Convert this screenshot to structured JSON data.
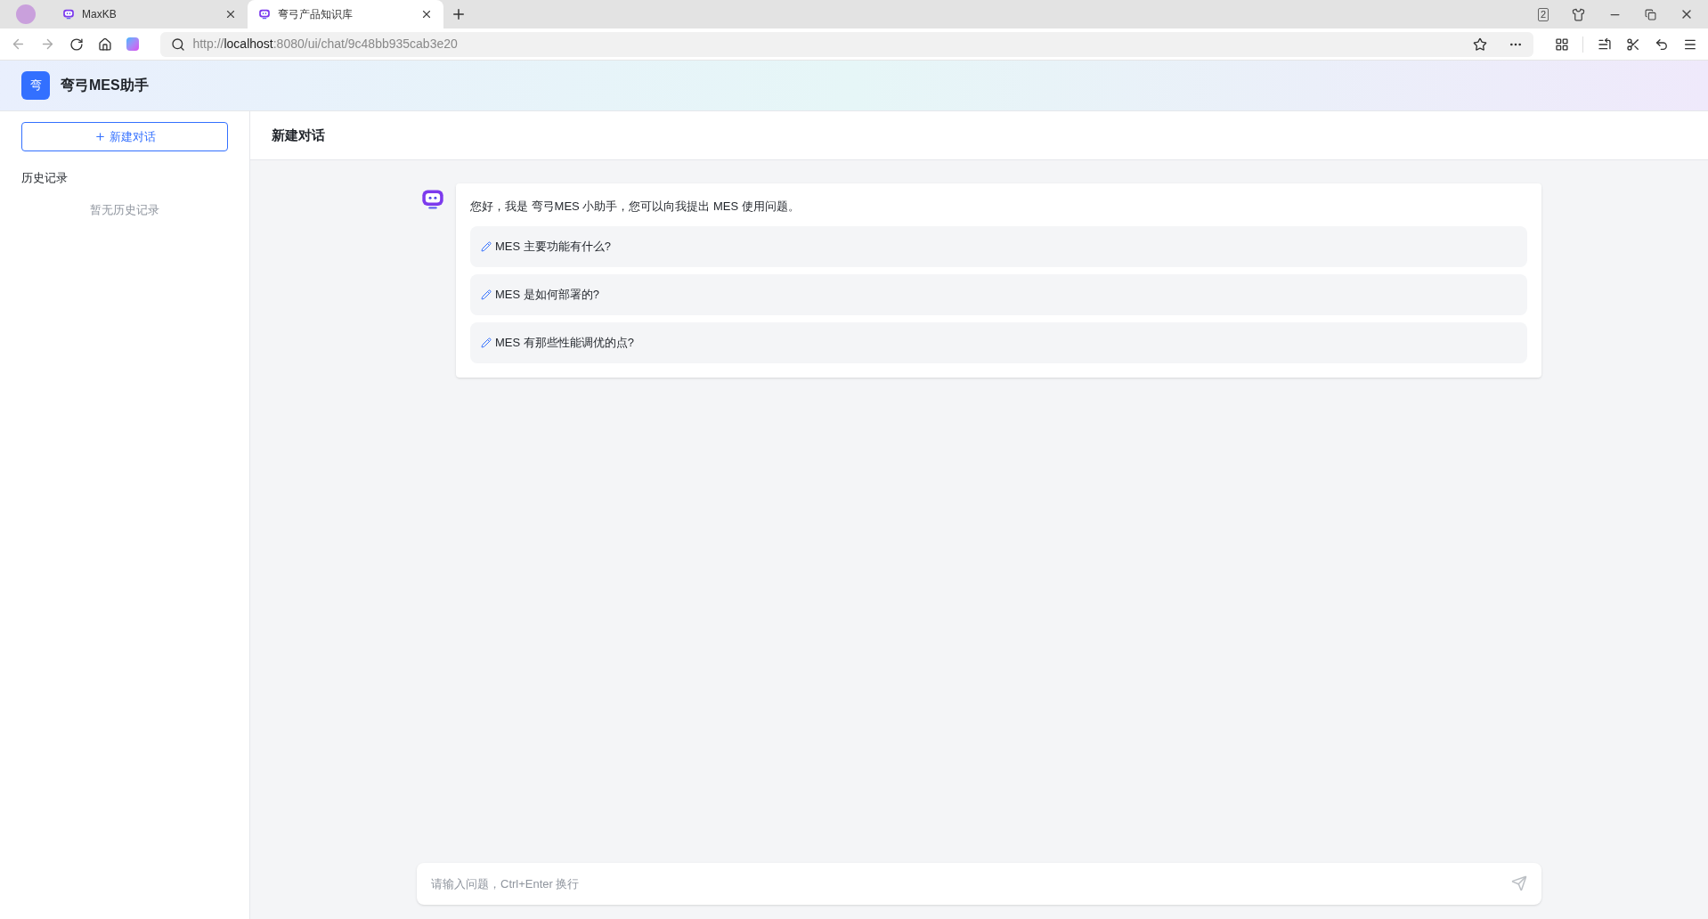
{
  "browser": {
    "tabs": [
      {
        "title": "MaxKB",
        "selected": false
      },
      {
        "title": "弯弓产品知识库",
        "selected": true
      }
    ],
    "tab_count": "2",
    "url": {
      "scheme": "http://",
      "host": "localhost",
      "rest": ":8080/ui/chat/9c48bb935cab3e20"
    }
  },
  "app": {
    "logo_text": "弯",
    "title": "弯弓MES助手"
  },
  "sidebar": {
    "new_chat": "新建对话",
    "history_title": "历史记录",
    "history_empty": "暂无历史记录"
  },
  "chat": {
    "title": "新建对话",
    "greeting": "您好，我是 弯弓MES 小助手，您可以向我提出 MES 使用问题。",
    "suggestions": [
      "MES 主要功能有什么?",
      "MES 是如何部署的?",
      "MES 有那些性能调优的点?"
    ],
    "input": {
      "placeholder": "请输入问题，Ctrl+Enter 换行"
    }
  }
}
